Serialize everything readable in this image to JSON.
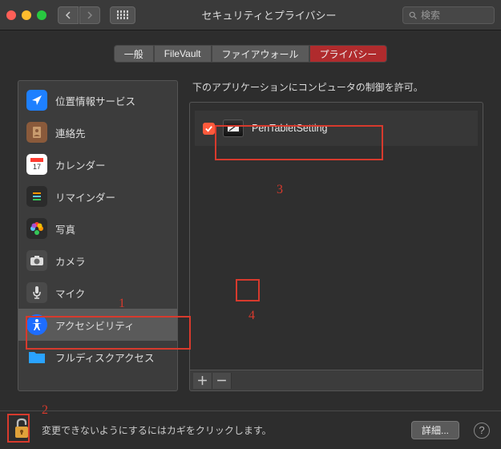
{
  "window": {
    "title": "セキュリティとプライバシー",
    "search_placeholder": "検索"
  },
  "tabs": [
    {
      "label": "一般"
    },
    {
      "label": "FileVault"
    },
    {
      "label": "ファイアウォール"
    },
    {
      "label": "プライバシー",
      "active": true
    }
  ],
  "sidebar": {
    "items": [
      {
        "label": "位置情報サービス",
        "icon": "location",
        "bg": "#1e80ff"
      },
      {
        "label": "連絡先",
        "icon": "contacts",
        "bg": "#8a5a3b"
      },
      {
        "label": "カレンダー",
        "icon": "calendar",
        "bg": "#ffffff"
      },
      {
        "label": "リマインダー",
        "icon": "reminders",
        "bg": "#2b2b2b"
      },
      {
        "label": "写真",
        "icon": "photos",
        "bg": "#2b2b2b"
      },
      {
        "label": "カメラ",
        "icon": "camera",
        "bg": "#4a4a4a"
      },
      {
        "label": "マイク",
        "icon": "mic",
        "bg": "#4a4a4a"
      },
      {
        "label": "アクセシビリティ",
        "icon": "accessibility",
        "bg": "#1e6dff",
        "selected": true
      },
      {
        "label": "フルディスクアクセス",
        "icon": "folder",
        "bg": "#2aa3ff"
      }
    ]
  },
  "right_panel": {
    "description": "下のアプリケーションにコンピュータの制御を許可。",
    "apps": [
      {
        "name": "PenTabletSetting",
        "checked": true
      }
    ]
  },
  "footer": {
    "text": "変更できないようにするにはカギをクリックします。",
    "details_label": "詳細..."
  },
  "annotations": {
    "n1": "1",
    "n2": "2",
    "n3": "3",
    "n4": "4"
  }
}
